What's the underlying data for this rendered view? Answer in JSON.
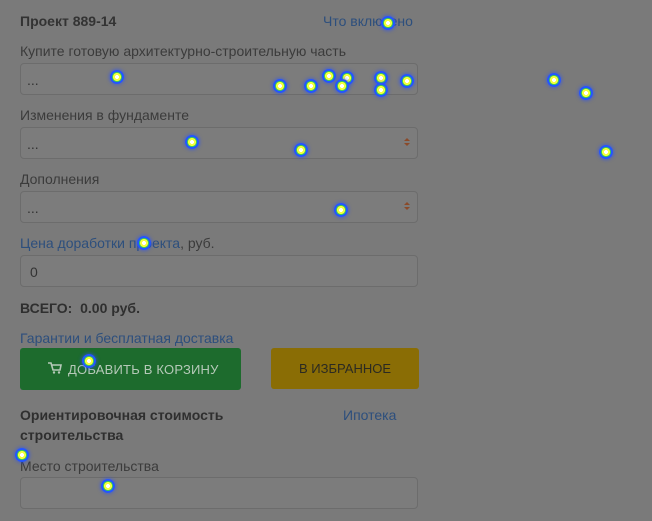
{
  "project": {
    "title": "Проект 889-14",
    "whats_included": "Что включено"
  },
  "fields": {
    "arch": {
      "label": "Купите готовую архитектурно-строительную часть",
      "value": "..."
    },
    "foundation": {
      "label": "Изменения в фундаменте",
      "value": "..."
    },
    "additions": {
      "label": "Дополнения",
      "value": "..."
    },
    "price": {
      "label_link": "Цена доработки проекта",
      "label_suffix": ", руб.",
      "value": "0"
    }
  },
  "total": {
    "label": "ВСЕГО:",
    "value": "0.00 руб."
  },
  "guarantees_link": "Гарантии и бесплатная доставка",
  "buttons": {
    "add_to_cart": "ДОБАВИТЬ В КОРЗИНУ",
    "favorites": "В ИЗБРАННОЕ"
  },
  "estimate": {
    "title": "Ориентировочная стоимость строительства",
    "mortgage": "Ипотека"
  },
  "location": {
    "label": "Место строительства",
    "value": ""
  },
  "colors": {
    "overlay_bg": "#7a7a7a",
    "cart_green": "#1d6b2d",
    "fav_yellow": "#8a6d05",
    "link": "#2d4f7d"
  },
  "icons": {
    "cart": "cart-icon",
    "gaze": "gaze-point-marker"
  }
}
